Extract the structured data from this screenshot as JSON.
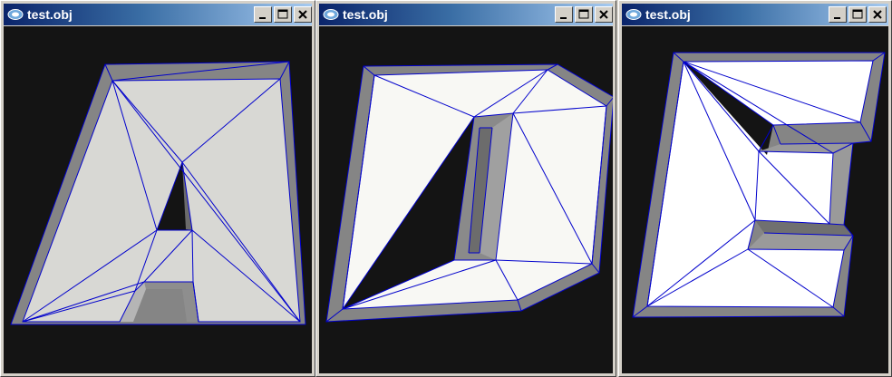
{
  "windows": [
    {
      "title": "test.obj",
      "letter": "A",
      "buttons": {
        "minimize": "minimize",
        "maximize": "maximize",
        "close": "close"
      }
    },
    {
      "title": "test.obj",
      "letter": "D",
      "buttons": {
        "minimize": "minimize",
        "maximize": "maximize",
        "close": "close"
      }
    },
    {
      "title": "test.obj",
      "letter": "E",
      "buttons": {
        "minimize": "minimize",
        "maximize": "maximize",
        "close": "close"
      }
    }
  ],
  "colors": {
    "titlebar_start": "#0a246a",
    "titlebar_end": "#a6caf0",
    "viewport_bg": "#141414",
    "mesh_edge": "#0000cc",
    "face_A": "#d8d8d4",
    "face_D": "#f8f8f4",
    "face_E": "#ffffff",
    "bevel": "#808080"
  }
}
